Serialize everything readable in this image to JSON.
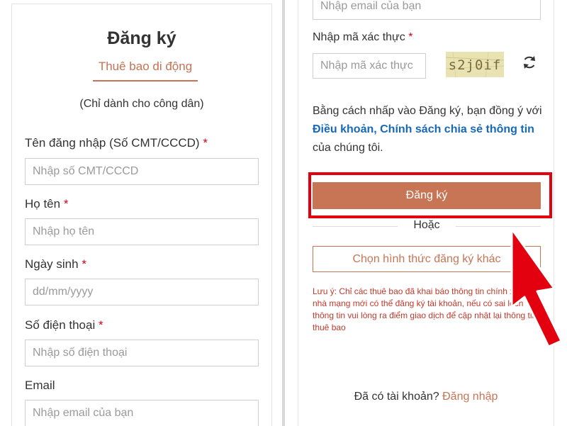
{
  "left_panel": {
    "title": "Đăng ký",
    "active_tab": "Thuê bao di động",
    "subtitle": "(Chỉ dành cho công dân)",
    "fields": [
      {
        "label": "Tên đăng nhập (Số CMT/CCCD)",
        "required": "*",
        "placeholder": "Nhập số CMT/CCCD"
      },
      {
        "label": "Họ tên",
        "required": "*",
        "placeholder": "Nhập họ tên"
      },
      {
        "label": "Ngày sinh",
        "required": "*",
        "placeholder": "dd/mm/yyyy"
      },
      {
        "label": "Số điện thoại",
        "required": "*",
        "placeholder": "Nhập số điện thoại"
      },
      {
        "label": "Email",
        "required": "",
        "placeholder": "Nhập email của bạn"
      }
    ]
  },
  "right_panel": {
    "email_placeholder": "Nhập email của bạn",
    "captcha": {
      "label": "Nhập mã xác thực",
      "required": "*",
      "placeholder": "Nhập mã xác thực",
      "image_text": "s2j0if"
    },
    "terms": {
      "prefix": "Bằng cách nhấp vào Đăng ký, bạn đồng ý với ",
      "link": "Điều khoản, Chính sách chia sẻ thông tin",
      "suffix": " của chúng tôi."
    },
    "submit_label": "Đăng ký",
    "or_label": "Hoặc",
    "alt_button_label": "Chọn hình thức đăng ký khác",
    "note": "Lưu ý: Chỉ các thuê bao đã khai báo thông tin chính xác với nhà mạng mới có thể đăng ký tài khoản, nếu có sai lệch thông tin vui lòng ra điểm giao dịch để cập nhật lại thông tin thuê bao",
    "login_prompt": "Đã có tài khoản?",
    "login_link": "Đăng nhập"
  },
  "colors": {
    "accent": "#c87556",
    "link": "#1668b8",
    "highlight": "#e3000f",
    "required": "#d0021b"
  },
  "icons": {
    "refresh": "refresh-icon",
    "arrow": "red-arrow-annotation"
  }
}
